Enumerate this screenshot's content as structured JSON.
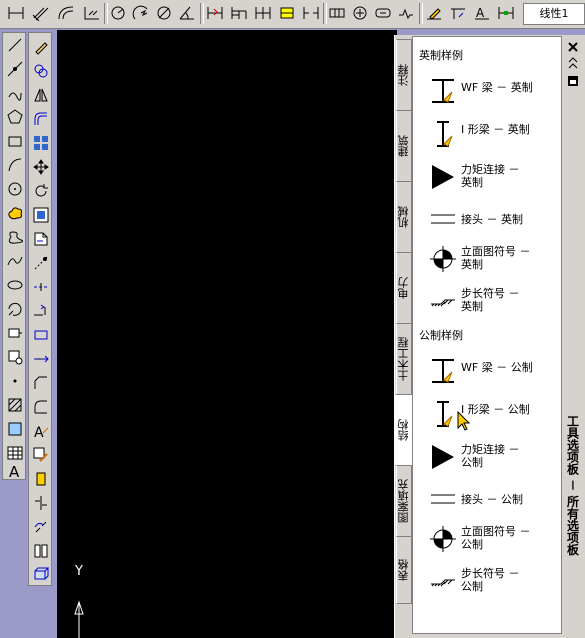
{
  "toolbar": {
    "dimstyle_value": "线性1",
    "icons": [
      "dim-linear-icon",
      "dim-aligned-icon",
      "dim-arc-icon",
      "dim-ordinate-icon",
      "dim-radius-icon",
      "dim-jogged-icon",
      "dim-diameter-icon",
      "dim-angular-icon",
      "dim-quick-icon",
      "dim-baseline-icon",
      "dim-continue-icon",
      "dim-space-icon",
      "dim-break-icon",
      "tolerance-icon",
      "center-mark-icon",
      "inspect-icon",
      "jogged-linear-icon",
      "dim-edit-icon",
      "dim-text-edit-icon",
      "dim-update-icon",
      "dim-style-icon"
    ]
  },
  "draw_toolbar": {
    "icons": [
      "line-icon",
      "construction-line-icon",
      "polyline-icon",
      "polygon-icon",
      "rectangle-icon",
      "arc-icon",
      "circle-icon",
      "revision-cloud-icon",
      "spline-icon",
      "ellipse-icon",
      "ellipse-arc-icon",
      "insert-block-icon",
      "make-block-icon",
      "point-icon",
      "hatch-icon",
      "gradient-icon",
      "region-icon",
      "table-icon",
      "mtext-icon"
    ]
  },
  "modify_toolbar": {
    "icons": [
      "erase-icon",
      "copy-icon",
      "mirror-icon",
      "offset-icon",
      "array-icon",
      "move-icon",
      "rotate-icon",
      "scale-icon",
      "stretch-icon",
      "trim-icon",
      "extend-icon",
      "break-at-point-icon",
      "break-icon",
      "join-icon",
      "chamfer-icon",
      "fillet-icon",
      "explode-icon"
    ]
  },
  "canvas": {
    "ucs_label": "Y"
  },
  "palette": {
    "title": "工具选项板 － 所有选项板",
    "tabs": [
      "注释",
      "建筑",
      "机械",
      "电力",
      "土木工程",
      "结构",
      "图案填充",
      "表格"
    ],
    "active_tab": "结构",
    "sections": [
      {
        "header": "英制样例",
        "items": [
          {
            "icon": "wf-beam-icon",
            "label": "WF 梁 － 英制"
          },
          {
            "icon": "i-beam-icon",
            "label": "I 形梁 － 英制"
          },
          {
            "icon": "moment-connection-icon",
            "label": "力矩连接 －\n英制"
          },
          {
            "icon": "joint-icon",
            "label": "接头 － 英制"
          },
          {
            "icon": "elevation-symbol-icon",
            "label": "立面图符号 －\n英制"
          },
          {
            "icon": "step-symbol-icon",
            "label": "步长符号 －\n英制"
          }
        ]
      },
      {
        "header": "公制样例",
        "items": [
          {
            "icon": "wf-beam-icon",
            "label": "WF 梁 － 公制"
          },
          {
            "icon": "i-beam-icon",
            "label": "I 形梁 － 公制"
          },
          {
            "icon": "moment-connection-icon",
            "label": "力矩连接 －\n公制"
          },
          {
            "icon": "joint-icon",
            "label": "接头 － 公制"
          },
          {
            "icon": "elevation-symbol-icon",
            "label": "立面图符号 －\n公制"
          },
          {
            "icon": "step-symbol-icon",
            "label": "步长符号 －\n公制"
          }
        ]
      }
    ]
  }
}
